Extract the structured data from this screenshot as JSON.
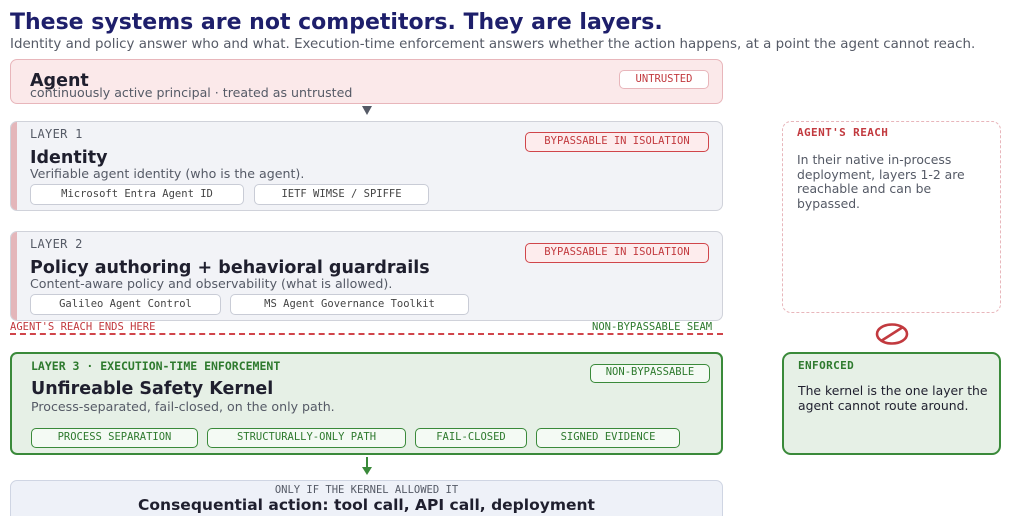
{
  "header": {
    "title": "These systems are not competitors. They are layers.",
    "subtitle": "Identity and policy answer who and what. Execution-time enforcement answers whether the action happens, at a point the agent cannot reach."
  },
  "agent": {
    "title": "Agent",
    "description": "continuously active principal · treated as untrusted",
    "badge": "UNTRUSTED"
  },
  "layer1": {
    "kicker": "LAYER 1",
    "title": "Identity",
    "description": "Verifiable agent identity (who is the agent).",
    "badge": "BYPASSABLE IN ISOLATION",
    "chips": [
      "Microsoft Entra Agent ID",
      "IETF WIMSE / SPIFFE"
    ]
  },
  "layer2": {
    "kicker": "LAYER 2",
    "title": "Policy authoring + behavioral guardrails",
    "description": "Content-aware policy and observability (what is allowed).",
    "badge": "BYPASSABLE IN ISOLATION",
    "chips": [
      "Galileo Agent Control",
      "MS Agent Governance Toolkit"
    ]
  },
  "seam": {
    "left_label": "AGENT'S REACH ENDS HERE",
    "right_label": "NON-BYPASSABLE SEAM"
  },
  "layer3": {
    "kicker": "LAYER 3 · EXECUTION-TIME ENFORCEMENT",
    "title": "Unfireable Safety Kernel",
    "description": "Process-separated, fail-closed, on the only path.",
    "badge": "NON-BYPASSABLE",
    "chips": [
      "PROCESS SEPARATION",
      "STRUCTURALLY-ONLY PATH",
      "FAIL-CLOSED",
      "SIGNED EVIDENCE"
    ]
  },
  "final": {
    "kicker": "ONLY IF THE KERNEL ALLOWED IT",
    "title": "Consequential action: tool call, API call, deployment"
  },
  "reach": {
    "title": "AGENT'S REACH",
    "body": "In their native in-process deployment, layers 1-2 are reachable and can be bypassed."
  },
  "enforced": {
    "title": "ENFORCED",
    "body": "The kernel is the one layer the agent cannot route around."
  },
  "icons": {
    "arrow_down": "triangle-down-icon",
    "prohibited": "no-entry-icon"
  },
  "colors": {
    "title": "#1e1f6b",
    "untrusted": "#c23a3f",
    "enforced": "#3a8a3a",
    "agent_fill": "#fbe9ea",
    "kernel_fill": "#e6f0e6"
  }
}
